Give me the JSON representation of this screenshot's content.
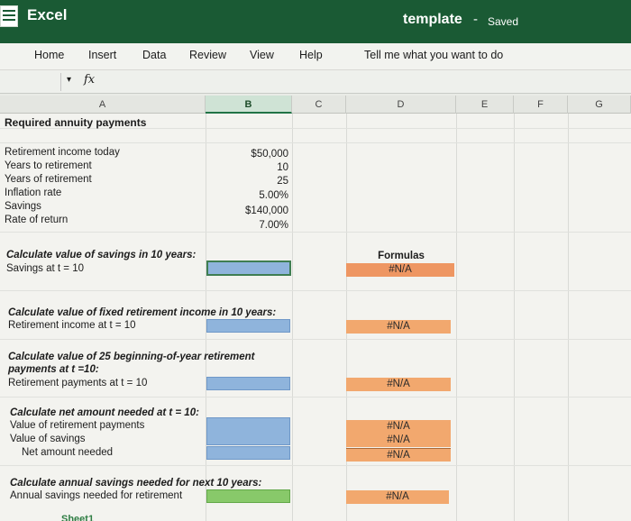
{
  "titlebar": {
    "app_name": "Excel",
    "doc_name": "template",
    "separator": "-",
    "status": "Saved"
  },
  "ribbon": {
    "tabs": [
      "Home",
      "Insert",
      "Data",
      "Review",
      "View",
      "Help"
    ],
    "tell_me": "Tell me what you want to do"
  },
  "formula_bar": {
    "fx": "fx",
    "value": ""
  },
  "columns": [
    "A",
    "B",
    "C",
    "D",
    "E",
    "F",
    "G"
  ],
  "sheet": {
    "title": "Required annuity payments",
    "inputs": [
      {
        "label": "Retirement income today",
        "value": "$50,000"
      },
      {
        "label": "Years to retirement",
        "value": "10"
      },
      {
        "label": "Years of retirement",
        "value": "25"
      },
      {
        "label": "Inflation rate",
        "value": "5.00%"
      },
      {
        "label": "Savings",
        "value": "$140,000"
      },
      {
        "label": "Rate of return",
        "value": "7.00%"
      }
    ],
    "sec1": {
      "heading": "Calculate value of savings in 10 years:",
      "label": "Savings at t = 10"
    },
    "formulas_header": "Formulas",
    "sec2": {
      "heading": "Calculate value of fixed retirement income in 10 years:",
      "label": "Retirement income at t = 10"
    },
    "sec3": {
      "heading1": "Calculate value of 25 beginning-of-year retirement",
      "heading2": "payments at t =10:",
      "label": "Retirement payments at t = 10"
    },
    "sec4": {
      "heading": "Calculate net amount needed at t = 10:",
      "label1": "Value of retirement payments",
      "label2": "Value of savings",
      "label3": "Net amount needed"
    },
    "sec5": {
      "heading": "Calculate annual savings needed for next 10 years:",
      "label": "Annual savings needed for retirement"
    },
    "na": "#N/A"
  },
  "sheet_tab": "Sheet1"
}
